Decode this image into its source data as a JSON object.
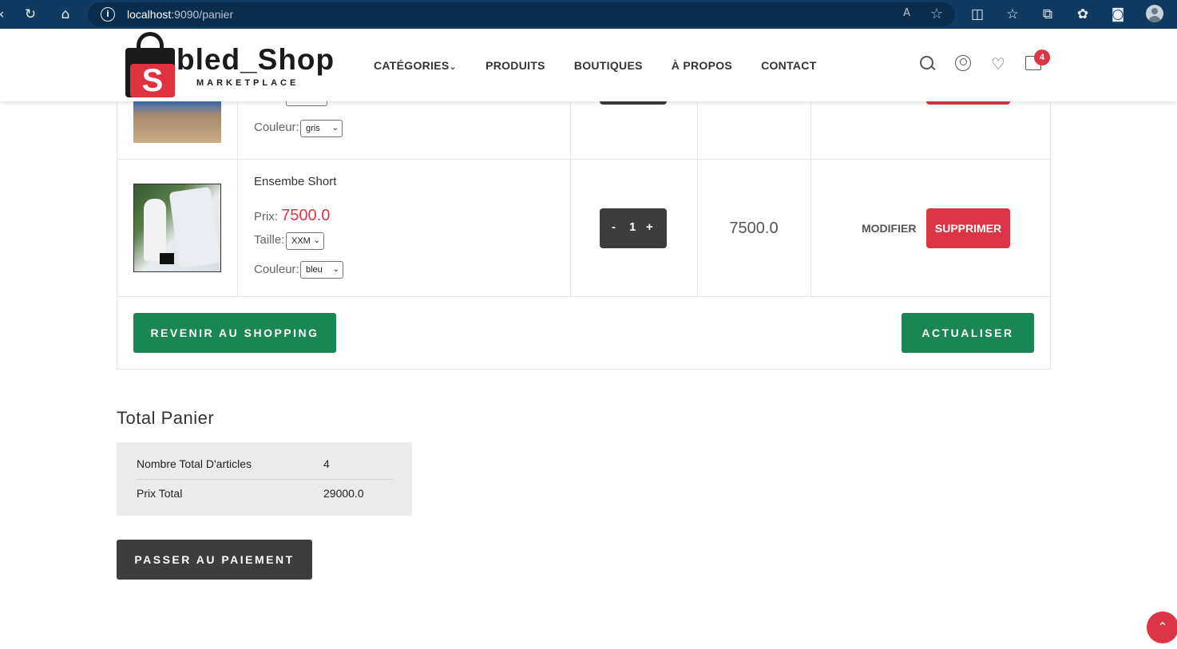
{
  "browser": {
    "url_host": "localhost",
    "url_path": ":9090/panier",
    "read_aloud_icon": "A",
    "favorite_icon": "☆"
  },
  "header": {
    "brand": "bled_Shop",
    "brand_sub": "MARKETPLACE",
    "logo_letter": "S",
    "nav": {
      "categories": "CATÉGORIES",
      "produits": "PRODUITS",
      "boutiques": "BOUTIQUES",
      "apropos": "À PROPOS",
      "contact": "CONTACT"
    },
    "cart_count": "4"
  },
  "cart": {
    "row1": {
      "couleur_label": "Couleur:",
      "couleur_value": "gris"
    },
    "row2": {
      "name": "Ensembe Short",
      "prix_label": "Prix:",
      "prix_value": "7500.0",
      "taille_label": "Taille:",
      "taille_value": "XXM",
      "couleur_label": "Couleur:",
      "couleur_value": "bleu",
      "qty_minus": "-",
      "qty_value": "1",
      "qty_plus": "+",
      "line_total": "7500.0",
      "modifier": "MODIFIER",
      "supprimer": "SUPPRIMER"
    },
    "continue_button": "REVENIR AU SHOPPING",
    "update_button": "ACTUALISER"
  },
  "totals": {
    "title": "Total Panier",
    "items_label": "Nombre Total D'articles",
    "items_value": "4",
    "price_label": "Prix Total",
    "price_value": "29000.0"
  },
  "checkout_button": "PASSER AU PAIEMENT",
  "colors": {
    "accent_red": "#dc3545",
    "accent_green": "#198754",
    "dark_button": "#3d3d3d",
    "browser_bar": "#0f3b63"
  }
}
